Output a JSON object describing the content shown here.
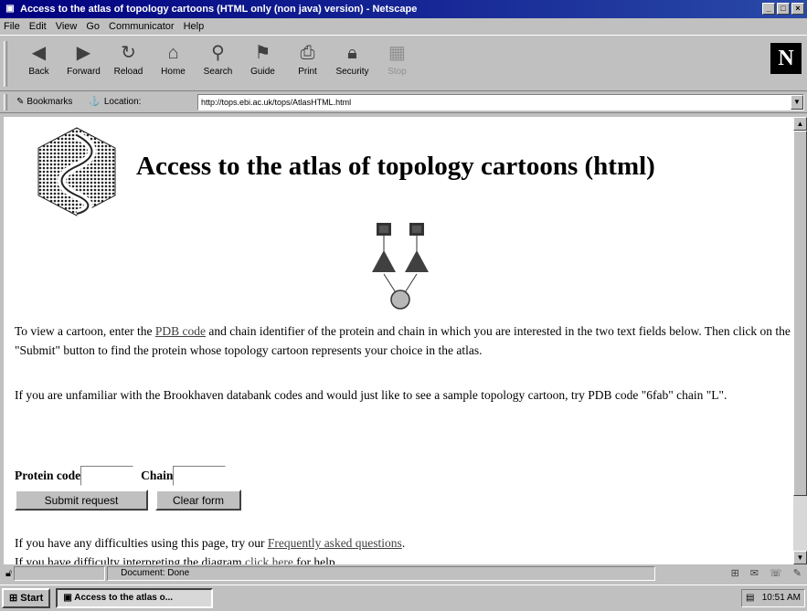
{
  "window": {
    "title": "Access to the atlas of topology cartoons (HTML only (non java) version) - Netscape",
    "controls": [
      "_",
      "□",
      "×"
    ]
  },
  "menu": [
    "File",
    "Edit",
    "View",
    "Go",
    "Communicator",
    "Help"
  ],
  "toolbar": {
    "buttons": [
      {
        "label": "Back",
        "icon": "back-arrow-icon"
      },
      {
        "label": "Forward",
        "icon": "forward-arrow-icon"
      },
      {
        "label": "Reload",
        "icon": "reload-icon"
      },
      {
        "label": "Home",
        "icon": "home-icon"
      },
      {
        "label": "Search",
        "icon": "search-icon"
      },
      {
        "label": "Guide",
        "icon": "guide-icon"
      },
      {
        "label": "Print",
        "icon": "print-icon"
      },
      {
        "label": "Security",
        "icon": "security-icon"
      },
      {
        "label": "Stop",
        "icon": "stop-icon"
      }
    ],
    "logo": "N"
  },
  "location": {
    "bookmarks_label": "Bookmarks",
    "location_label": "Location:",
    "url": "http://tops.ebi.ac.uk/tops/AtlasHTML.html"
  },
  "page": {
    "heading": "Access to the atlas of topology cartoons (html)",
    "intro_a": "To view a cartoon, enter the ",
    "intro_link": "PDB code",
    "intro_b": " and chain identifier of the protein and chain in which you are interested in the two text fields below. Then click on the \"Submit\" button to find the protein whose topology cartoon represents your choice in the atlas.",
    "sample_text": "If you are unfamiliar with the Brookhaven databank codes and would just like to see a sample topology cartoon, try PDB code \"6fab\" chain \"L\".",
    "form": {
      "protein_code_label": "Protein code",
      "protein_code_value": "",
      "chain_label": "Chain",
      "chain_value": "",
      "submit_label": "Submit request",
      "clear_label": "Clear form"
    },
    "help1_a": "If you have any difficulties using this page, try our ",
    "help1_link": "Frequently asked questions",
    "help1_b": ".",
    "help2_a": "If you have difficulty interpreting the diagram ",
    "help2_link": "click here",
    "help2_b": " for help."
  },
  "status": {
    "text": "Document: Done"
  },
  "taskbar": {
    "start_label": "Start",
    "task_label": "Access to the atlas o...",
    "clock": "10:51 AM"
  }
}
